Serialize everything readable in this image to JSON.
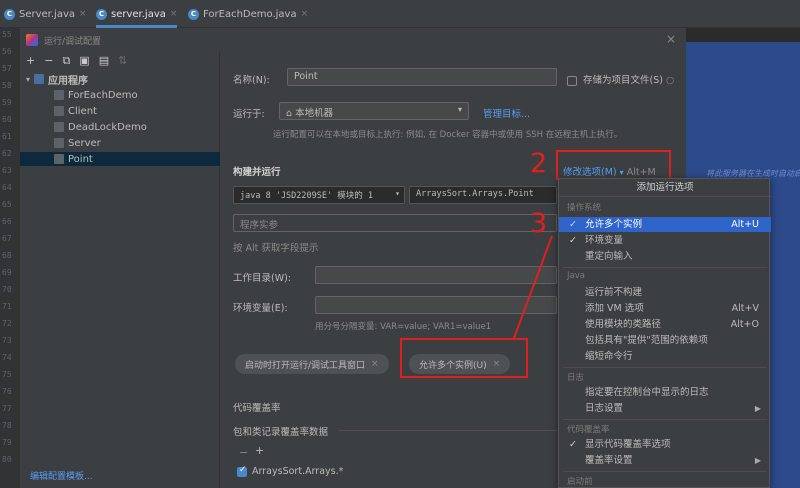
{
  "editor_tabs": [
    {
      "label": "Server.java"
    },
    {
      "label": "server.java"
    },
    {
      "label": "ForEachDemo.java"
    }
  ],
  "gutter_lines": [
    "55",
    "56",
    "57",
    "58",
    "59",
    "60",
    "61",
    "62",
    "63",
    "64",
    "65",
    "66",
    "67",
    "68",
    "69",
    "70",
    "71",
    "72",
    "73",
    "74",
    "75",
    "76",
    "77",
    "78",
    "79",
    "80"
  ],
  "dialog": {
    "title": "运行/调试配置",
    "tree": {
      "group_label": "应用程序",
      "items": [
        "ForEachDemo",
        "Client",
        "DeadLockDemo",
        "Server",
        "Point"
      ],
      "selected": "Point"
    },
    "edit_templates_link": "编辑配置模板...",
    "name_label": "名称(N):",
    "name_value": "Point",
    "store_as_file_label": "存储为项目文件(S)",
    "run_on_label": "运行于:",
    "run_on_value": "本地机器",
    "manage_targets_link": "管理目标...",
    "run_on_hint": "运行配置可以在本地或目标上执行: 例如, 在 Docker 容器中或使用 SSH 在远程主机上执行。",
    "build_run_label": "构建并运行",
    "modify_options_label": "修改选项(M)",
    "modify_options_shortcut": "Alt+M",
    "jdk_value": "java 8  'JSD2209SE'  模块的 1",
    "main_class_value": "ArraysSort.Arrays.Point",
    "program_args_placeholder": "程序实参",
    "alt_hint": "按 Alt 获取字段提示",
    "working_dir_label": "工作目录(W):",
    "env_label": "环境变量(E):",
    "env_hint": "用分号分隔变量: VAR=value; VAR1=value1",
    "chips": [
      {
        "label": "启动时打开运行/调试工具窗口"
      },
      {
        "label": "允许多个实例(U)"
      }
    ],
    "coverage_label": "代码覆盖率",
    "coverage_packages_label": "包和类记录覆盖率数据",
    "coverage_entry": "ArraysSort.Arrays.*"
  },
  "annotations": {
    "step2": "2",
    "step3": "3",
    "color": "#e02020"
  },
  "editor_hint": "将此服务器在生成时自动启动",
  "menu": {
    "title": "添加运行选项",
    "sections": [
      {
        "name": "操作系统",
        "items": [
          {
            "label": "允许多个实例",
            "checked": true,
            "shortcut": "Alt+U",
            "selected": true
          },
          {
            "label": "环境变量",
            "checked": true,
            "shortcut": ""
          },
          {
            "label": "重定向输入",
            "checked": false,
            "shortcut": ""
          }
        ]
      },
      {
        "name": "Java",
        "items": [
          {
            "label": "运行前不构建",
            "checked": false,
            "shortcut": ""
          },
          {
            "label": "添加 VM 选项",
            "checked": false,
            "shortcut": "Alt+V"
          },
          {
            "label": "使用模块的类路径",
            "checked": false,
            "shortcut": "Alt+O"
          },
          {
            "label": "包括具有\"提供\"范围的依赖项",
            "checked": false,
            "shortcut": ""
          },
          {
            "label": "缩短命令行",
            "checked": false,
            "shortcut": ""
          }
        ]
      },
      {
        "name": "日志",
        "items": [
          {
            "label": "指定要在控制台中显示的日志",
            "checked": false,
            "shortcut": ""
          },
          {
            "label": "日志设置",
            "checked": false,
            "shortcut": "",
            "submenu": true
          }
        ]
      },
      {
        "name": "代码覆盖率",
        "items": [
          {
            "label": "显示代码覆盖率选项",
            "checked": true,
            "shortcut": ""
          },
          {
            "label": "覆盖率设置",
            "checked": false,
            "shortcut": "",
            "submenu": true
          }
        ]
      },
      {
        "name": "启动前",
        "items": []
      }
    ]
  },
  "colors": {
    "accent": "#4a88c7",
    "selection": "#2f65ca",
    "annotation": "#e02020",
    "link": "#589df6"
  }
}
